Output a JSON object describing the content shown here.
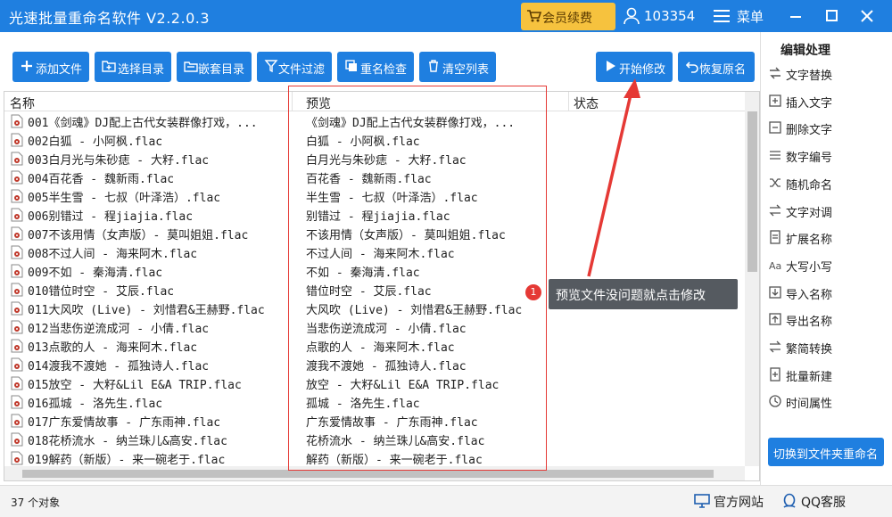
{
  "app": {
    "title": "光速批量重命名软件 V2.2.0.3",
    "vip_label": "会员续费",
    "user_id": "103354",
    "menu_label": "菜单"
  },
  "toolbar": {
    "add_file": "添加文件",
    "select_dir": "选择目录",
    "nested_dir": "嵌套目录",
    "file_filter": "文件过滤",
    "dup_check": "重名检查",
    "clear_list": "清空列表",
    "start_modify": "开始修改",
    "restore_name": "恢复原名"
  },
  "list": {
    "columns": {
      "name": "名称",
      "preview": "预览",
      "status": "状态"
    },
    "rows": [
      {
        "name": "001《剑魂》DJ配上古代女装群像打戏，...",
        "preview": "《剑魂》DJ配上古代女装群像打戏，..."
      },
      {
        "name": "002白狐 - 小阿枫.flac",
        "preview": "白狐 - 小阿枫.flac"
      },
      {
        "name": "003白月光与朱砂痣 - 大籽.flac",
        "preview": "白月光与朱砂痣 - 大籽.flac"
      },
      {
        "name": "004百花香 - 魏新雨.flac",
        "preview": "百花香 - 魏新雨.flac"
      },
      {
        "name": "005半生雪 - 七叔（叶泽浩）.flac",
        "preview": "半生雪 - 七叔（叶泽浩）.flac"
      },
      {
        "name": "006别错过 - 程jiajia.flac",
        "preview": "别错过 - 程jiajia.flac"
      },
      {
        "name": "007不该用情（女声版）- 莫叫姐姐.flac",
        "preview": "不该用情（女声版）- 莫叫姐姐.flac"
      },
      {
        "name": "008不过人间 - 海来阿木.flac",
        "preview": "不过人间 - 海来阿木.flac"
      },
      {
        "name": "009不如 - 秦海清.flac",
        "preview": "不如 - 秦海清.flac"
      },
      {
        "name": "010错位时空 - 艾辰.flac",
        "preview": "错位时空 - 艾辰.flac"
      },
      {
        "name": "011大风吹 (Live) - 刘惜君&王赫野.flac",
        "preview": "大风吹 (Live) - 刘惜君&王赫野.flac"
      },
      {
        "name": "012当悲伤逆流成河 - 小倩.flac",
        "preview": "当悲伤逆流成河 - 小倩.flac"
      },
      {
        "name": "013点歌的人 - 海来阿木.flac",
        "preview": "点歌的人 - 海来阿木.flac"
      },
      {
        "name": "014渡我不渡她 - 孤独诗人.flac",
        "preview": "渡我不渡她 - 孤独诗人.flac"
      },
      {
        "name": "015放空 - 大籽&Lil E&A TRIP.flac",
        "preview": "放空 - 大籽&Lil E&A TRIP.flac"
      },
      {
        "name": "016孤城 - 洛先生.flac",
        "preview": "孤城 - 洛先生.flac"
      },
      {
        "name": "017广东爱情故事 - 广东雨神.flac",
        "preview": "广东爱情故事 - 广东雨神.flac"
      },
      {
        "name": "018花桥流水 - 纳兰珠儿&高安.flac",
        "preview": "花桥流水 - 纳兰珠儿&高安.flac"
      },
      {
        "name": "019解药（新版）- 来一碗老于.flac",
        "preview": "解药（新版）- 来一碗老于.flac"
      }
    ]
  },
  "callout": {
    "badge": "1",
    "text": "预览文件没问题就点击修改"
  },
  "sidebar": {
    "title": "编辑处理",
    "items": [
      {
        "label": "文字替换",
        "icon": "replace-icon"
      },
      {
        "label": "插入文字",
        "icon": "insert-icon"
      },
      {
        "label": "删除文字",
        "icon": "delete-text-icon"
      },
      {
        "label": "数字编号",
        "icon": "number-icon"
      },
      {
        "label": "随机命名",
        "icon": "shuffle-icon"
      },
      {
        "label": "文字对调",
        "icon": "swap-icon"
      },
      {
        "label": "扩展名称",
        "icon": "extension-icon"
      },
      {
        "label": "大写小写",
        "icon": "case-icon"
      },
      {
        "label": "导入名称",
        "icon": "import-icon"
      },
      {
        "label": "导出名称",
        "icon": "export-icon"
      },
      {
        "label": "繁简转换",
        "icon": "convert-icon"
      },
      {
        "label": "批量新建",
        "icon": "batch-new-icon"
      },
      {
        "label": "时间属性",
        "icon": "clock-icon"
      }
    ],
    "switch_label": "切换到文件夹重命名"
  },
  "status": {
    "count": "37 个对象",
    "site_label": "官方网站",
    "qq_label": "QQ客服"
  },
  "colors": {
    "primary": "#1f7fe0",
    "vip": "#f6c23e",
    "highlight": "#e53935",
    "tooltip": "#555a60"
  }
}
